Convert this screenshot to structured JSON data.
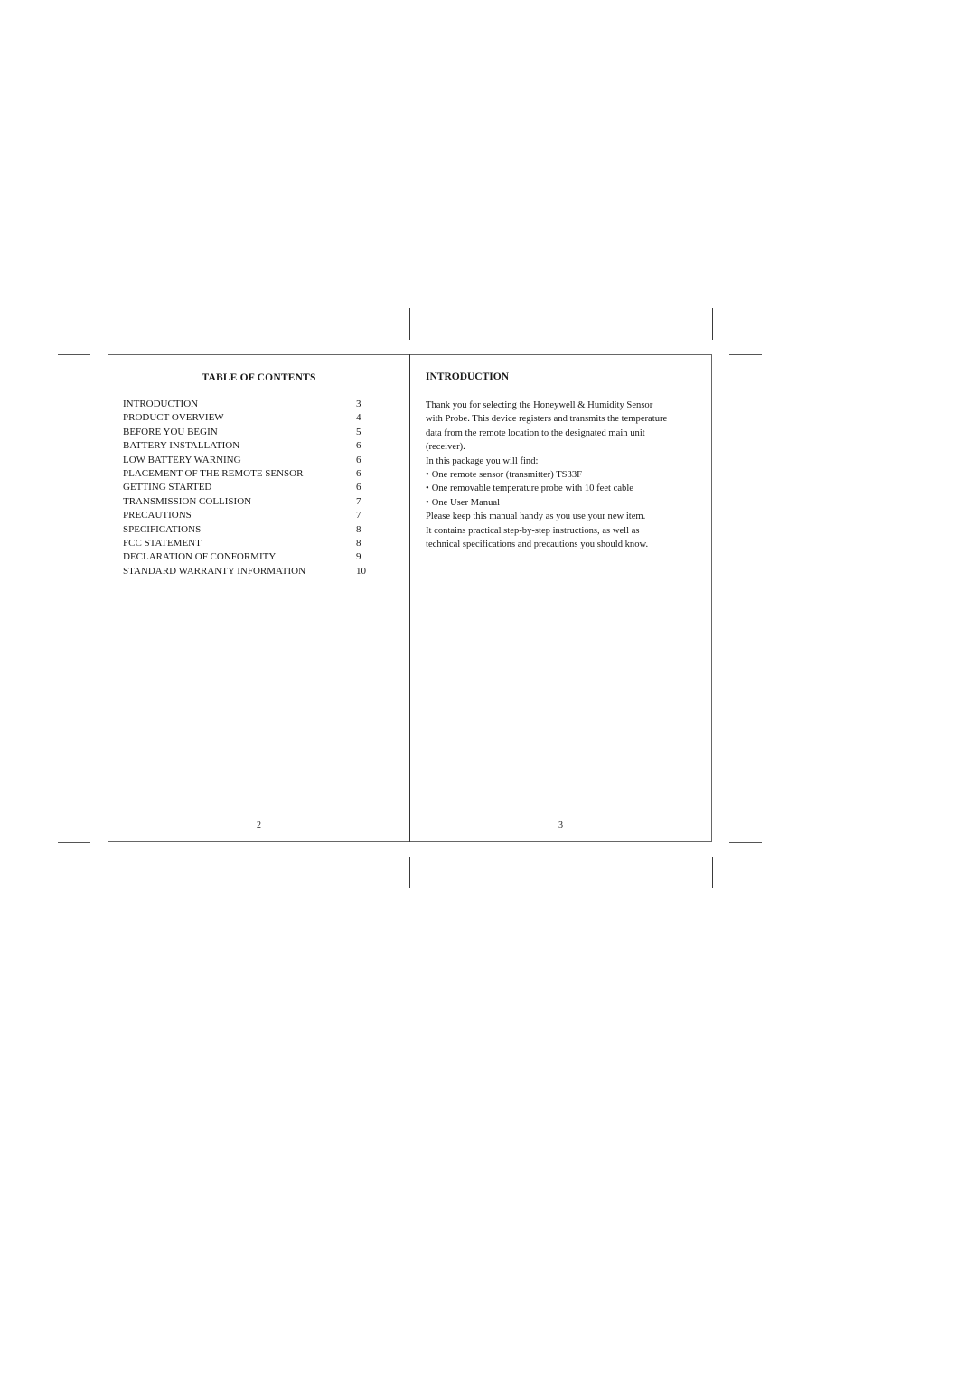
{
  "left_page": {
    "title": "TABLE OF CONTENTS",
    "entries": [
      {
        "label": "INTRODUCTION",
        "page": "3"
      },
      {
        "label": "PRODUCT OVERVIEW",
        "page": "4"
      },
      {
        "label": "BEFORE YOU BEGIN",
        "page": "5"
      },
      {
        "label": "BATTERY INSTALLATION",
        "page": "6"
      },
      {
        "label": "LOW BATTERY WARNING",
        "page": "6"
      },
      {
        "label": "PLACEMENT OF THE REMOTE SENSOR",
        "page": "6"
      },
      {
        "label": "GETTING STARTED",
        "page": "6"
      },
      {
        "label": "TRANSMISSION COLLISION",
        "page": "7"
      },
      {
        "label": "PRECAUTIONS",
        "page": "7"
      },
      {
        "label": "SPECIFICATIONS",
        "page": "8"
      },
      {
        "label": "FCC STATEMENT",
        "page": "8"
      },
      {
        "label": "DECLARATION OF CONFORMITY",
        "page": "9"
      },
      {
        "label": "STANDARD WARRANTY INFORMATION",
        "page": "10"
      }
    ],
    "page_number": "2"
  },
  "right_page": {
    "title": "INTRODUCTION",
    "paragraph1_lines": [
      "Thank you for selecting the Honeywell & Humidity Sensor",
      "with Probe. This device registers and transmits the temperature",
      "data from the remote location to the designated main unit",
      "(receiver)."
    ],
    "package_intro": "In this package you will find:",
    "package_items": [
      "One remote sensor (transmitter) TS33F",
      "One removable temperature probe with 10 feet cable",
      "One User Manual"
    ],
    "closing_lines": [
      "Please keep this manual handy as you use your new item.",
      "It contains practical step-by-step instructions, as well as",
      "technical specifications and precautions you should know."
    ],
    "page_number": "3"
  }
}
